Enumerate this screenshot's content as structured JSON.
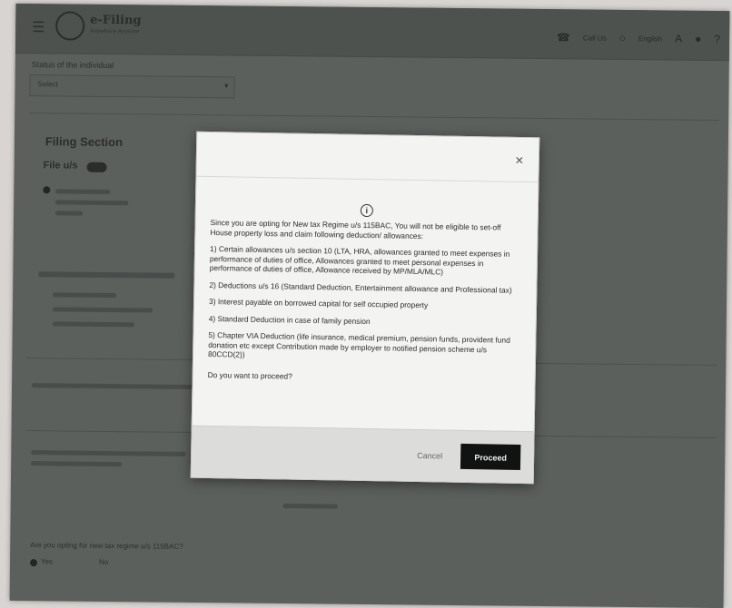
{
  "header": {
    "logo_text": "e-Filing",
    "logo_subtitle": "Anywhere Anytime",
    "call_us": "Call Us",
    "language": "English"
  },
  "background": {
    "status_label": "Status of the individual",
    "status_value": "Select",
    "section_title": "Filing Section",
    "file_us_label": "File u/s",
    "bottom_question": "Are you opting for new tax regime u/s 115BAC?",
    "radio_yes": "Yes",
    "radio_no": "No"
  },
  "modal": {
    "paragraphs": [
      "Since you are opting for New tax Regime u/s 115BAC, You will not be eligible to set-off House property loss and claim following deduction/ allowances:",
      "1) Certain allowances u/s section 10 (LTA, HRA, allowances granted to meet expenses in performance of duties of office, Allowances granted to meet personal expenses in performance of duties of office, Allowance received by MP/MLA/MLC)",
      "2) Deductions u/s 16 (Standard Deduction, Entertainment allowance and Professional tax)",
      "3) Interest payable on borrowed capital for self occupied property",
      "4) Standard Deduction in case of family pension",
      "5) Chapter VIA Deduction (life insurance, medical premium, pension funds, provident fund donation etc except Contribution made by employer to notified pension scheme u/s 80CCD(2))",
      "Do you want to proceed?"
    ],
    "cancel_label": "Cancel",
    "proceed_label": "Proceed"
  }
}
